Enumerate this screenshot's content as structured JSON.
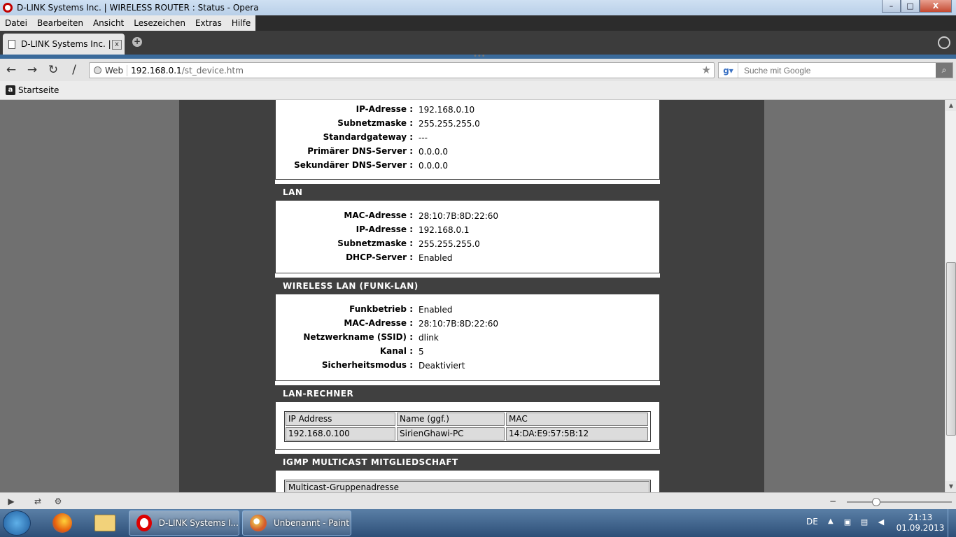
{
  "window": {
    "title": "D-LINK Systems Inc. | WIRELESS ROUTER : Status - Opera",
    "minimize": "–",
    "maximize": "□",
    "close": "X"
  },
  "menu": [
    "Datei",
    "Bearbeiten",
    "Ansicht",
    "Lesezeichen",
    "Extras",
    "Hilfe"
  ],
  "tab": {
    "label": "D-LINK Systems Inc. | ...",
    "close": "x",
    "new_tab": "+"
  },
  "navbar": {
    "back": "←",
    "forward": "→",
    "reload": "↻",
    "edit": "/"
  },
  "address": {
    "label": "Web",
    "host": "192.168.0.1",
    "path": "/st_device.htm",
    "star": "★"
  },
  "search": {
    "engine": "g▾",
    "placeholder": "Suche mit Google",
    "button": "⌕"
  },
  "bookmarks": {
    "icon": "a",
    "items": [
      "Startseite"
    ]
  },
  "wan": {
    "rows": [
      {
        "key": "IP-Adresse :",
        "value": "192.168.0.10"
      },
      {
        "key": "Subnetzmaske :",
        "value": "255.255.255.0"
      },
      {
        "key": "Standardgateway :",
        "value": "---"
      },
      {
        "key": "Primärer DNS-Server :",
        "value": "0.0.0.0"
      },
      {
        "key": "Sekundärer DNS-Server :",
        "value": "0.0.0.0"
      }
    ]
  },
  "lan": {
    "title": "LAN",
    "rows": [
      {
        "key": "MAC-Adresse :",
        "value": "28:10:7B:8D:22:60"
      },
      {
        "key": "IP-Adresse :",
        "value": "192.168.0.1"
      },
      {
        "key": "Subnetzmaske :",
        "value": "255.255.255.0"
      },
      {
        "key": "DHCP-Server :",
        "value": "Enabled"
      }
    ]
  },
  "wlan": {
    "title": "WIRELESS LAN (FUNK-LAN)",
    "rows": [
      {
        "key": "Funkbetrieb :",
        "value": "Enabled"
      },
      {
        "key": "MAC-Adresse :",
        "value": "28:10:7B:8D:22:60"
      },
      {
        "key": "Netzwerkname (SSID) :",
        "value": "dlink"
      },
      {
        "key": "Kanal :",
        "value": "5"
      },
      {
        "key": "Sicherheitsmodus :",
        "value": "Deaktiviert"
      }
    ]
  },
  "lan_clients": {
    "title": "LAN-RECHNER",
    "headers": [
      "IP Address",
      "Name (ggf.)",
      "MAC"
    ],
    "rows": [
      [
        "192.168.0.100",
        "SirienGhawi-PC",
        "14:DA:E9:57:5B:12"
      ]
    ]
  },
  "igmp": {
    "title": "IGMP MULTICAST MITGLIEDSCHAFT",
    "headers": [
      "Multicast-Gruppenadresse"
    ]
  },
  "scrollbar": {
    "up": "▲",
    "down": "▼"
  },
  "statusbar": {
    "icons": [
      "▶",
      "⇄",
      "⚙",
      "−"
    ]
  },
  "taskbar": {
    "tasks": [
      {
        "label": "D-LINK Systems I..."
      },
      {
        "label": "Unbenannt - Paint"
      }
    ],
    "language": "DE",
    "tray_caret": "▲",
    "tray_icons": [
      "▣",
      "▤",
      "◀"
    ],
    "time": "21:13",
    "date": "01.09.2013"
  }
}
